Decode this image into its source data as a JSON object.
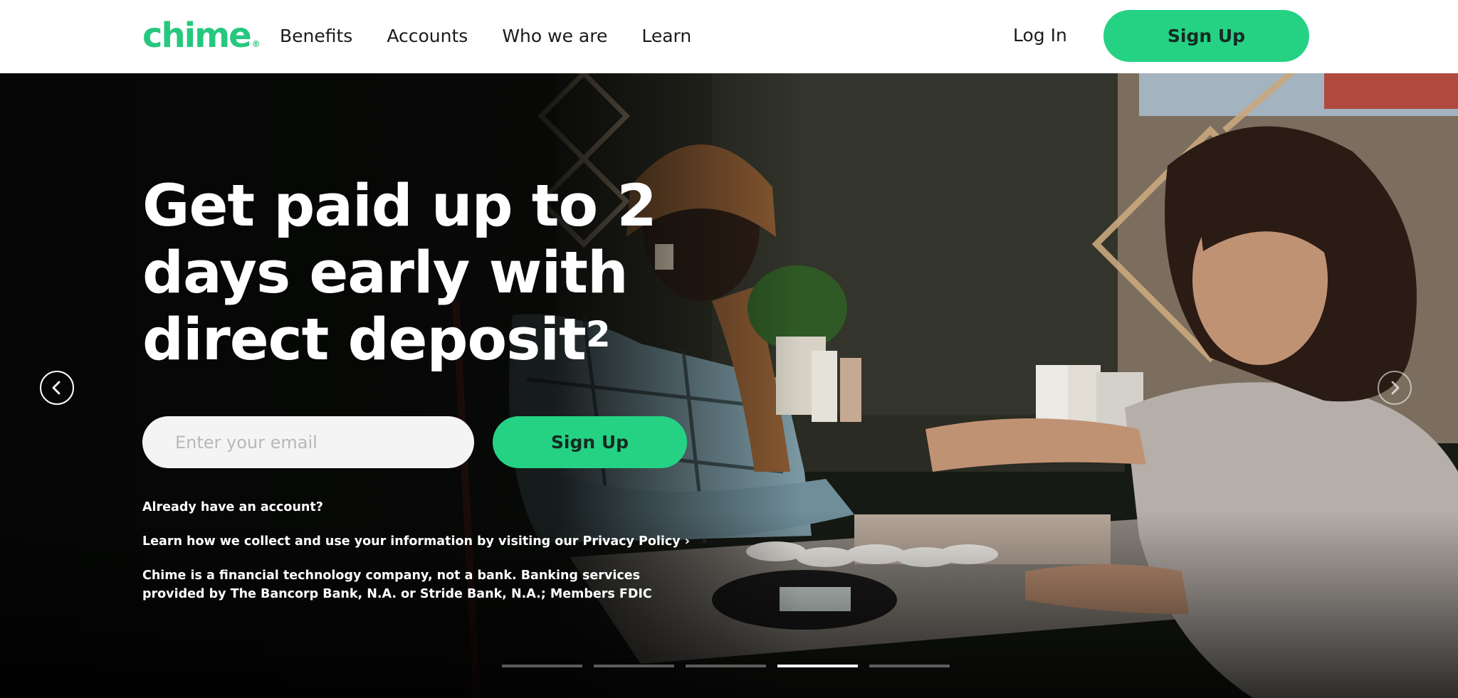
{
  "brand": {
    "logo_text": "chime",
    "logo_mark": "®",
    "accent": "#25d284"
  },
  "nav": {
    "items": [
      {
        "label": "Benefits"
      },
      {
        "label": "Accounts"
      },
      {
        "label": "Who we are"
      },
      {
        "label": "Learn"
      }
    ],
    "login_label": "Log In",
    "signup_label": "Sign Up"
  },
  "hero": {
    "headline": "Get paid up to 2 days early with direct deposit",
    "headline_footnote": "2",
    "email_placeholder": "Enter your email",
    "signup_label": "Sign Up",
    "already_account": "Already have an account?",
    "privacy_prefix": "Learn how we collect and use your information by visiting our ",
    "privacy_link": "Privacy Policy ›",
    "disclaimer": "Chime is a financial technology company, not a bank. Banking services provided by The Bancorp Bank, N.A. or Stride Bank, N.A.; Members FDIC",
    "carousel": {
      "slide_count": 5,
      "active_index": 3
    }
  },
  "icons": {
    "prev": "chevron-left-icon",
    "next": "chevron-right-icon"
  }
}
